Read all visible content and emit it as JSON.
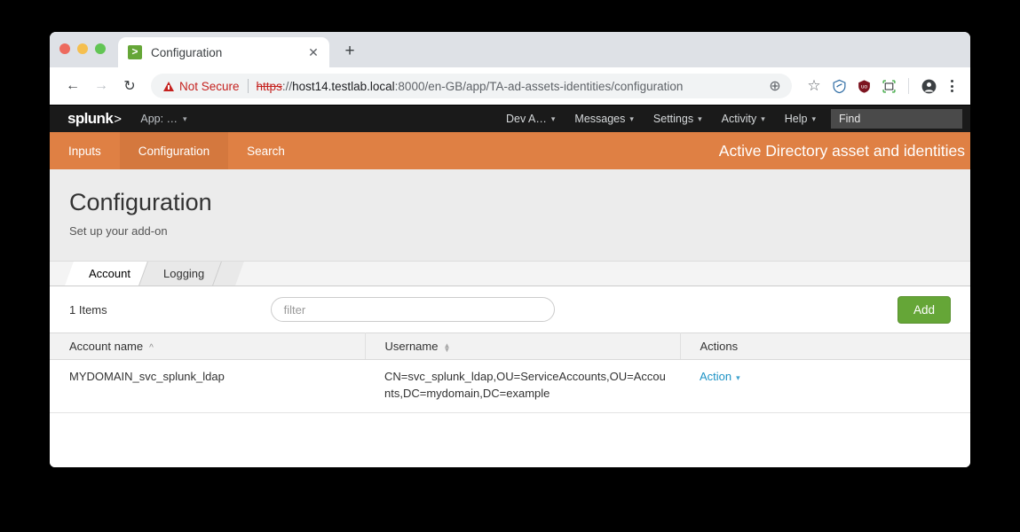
{
  "browser": {
    "traffic_lights": [
      "close",
      "minimize",
      "maximize"
    ],
    "tab": {
      "title": "Configuration",
      "favicon_glyph": ">",
      "favicon_name": "splunk-favicon",
      "close_label": "✕"
    },
    "new_tab_label": "+",
    "nav": {
      "back": "←",
      "forward": "→",
      "reload": "↻"
    },
    "omnibox": {
      "security_label": "Not Secure",
      "scheme": "https",
      "scheme_sep": "://",
      "host": "host14.testlab.local",
      "path": ":8000/en-GB/app/TA-ad-assets-identities/configuration",
      "zoom_icon": "⊕",
      "bookmark_icon": "☆"
    },
    "extensions": [
      "shield-extension-icon",
      "ublock-origin-icon",
      "screenshot-capture-icon"
    ],
    "profile_icon": "profile-avatar-icon",
    "menu_icon": "kebab-menu-icon"
  },
  "splunk_bar": {
    "logo_text": "splunk",
    "logo_arrow": ">",
    "app_menu": "App: …",
    "nav_items": [
      {
        "label": "Dev A…",
        "caret": "⌄"
      },
      {
        "label": "Messages",
        "caret": "⌄"
      },
      {
        "label": "Settings",
        "caret": "⌄"
      },
      {
        "label": "Activity",
        "caret": "⌄"
      },
      {
        "label": "Help",
        "caret": "⌄"
      }
    ],
    "find_label": "Find"
  },
  "app_bar": {
    "tabs": [
      {
        "label": "Inputs",
        "active": false
      },
      {
        "label": "Configuration",
        "active": true
      },
      {
        "label": "Search",
        "active": false
      }
    ],
    "title": "Active Directory asset and identities",
    "color": "#df8044",
    "active_color": "#d4783e"
  },
  "page_head": {
    "title": "Configuration",
    "subtitle": "Set up your add-on"
  },
  "sub_tabs": [
    {
      "label": "Account",
      "active": true
    },
    {
      "label": "Logging",
      "active": false
    }
  ],
  "toolbar": {
    "item_count": "1 Items",
    "filter_placeholder": "filter",
    "filter_value": "",
    "add_label": "Add",
    "add_color": "#65a637"
  },
  "table": {
    "columns": [
      {
        "label": "Account name",
        "sort": "asc"
      },
      {
        "label": "Username",
        "sort": "none"
      },
      {
        "label": "Actions",
        "sort": null
      }
    ],
    "rows": [
      {
        "account_name": "MYDOMAIN_svc_splunk_ldap",
        "username": "CN=svc_splunk_ldap,OU=ServiceAccounts,OU=Accounts,DC=mydomain,DC=example",
        "action_label": "Action",
        "action_caret": "⌄"
      }
    ],
    "link_color": "#1e93c6"
  }
}
